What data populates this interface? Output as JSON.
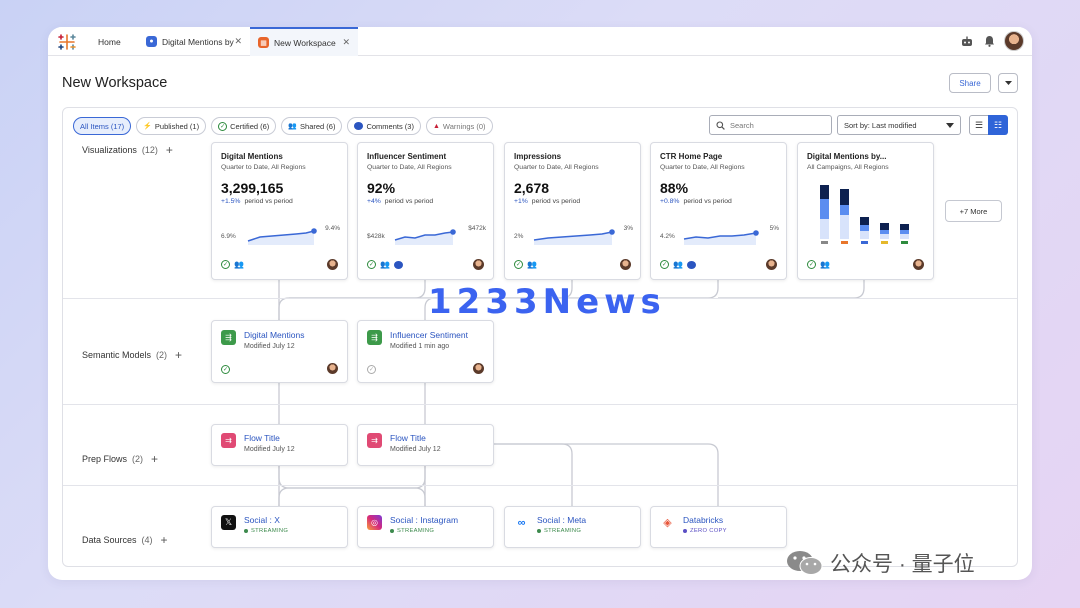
{
  "tabs": {
    "home": "Home",
    "tab1": "Digital Mentions by",
    "tab2": "New Workspace"
  },
  "page": {
    "title": "New Workspace",
    "share": "Share"
  },
  "filters": [
    {
      "label": "All Items (17)",
      "icon": "",
      "active": true
    },
    {
      "label": "Published (1)",
      "icon": "bolt-icon"
    },
    {
      "label": "Certified (6)",
      "icon": "certified-icon"
    },
    {
      "label": "Shared (6)",
      "icon": "shared-icon"
    },
    {
      "label": "Comments (3)",
      "icon": "comment-icon"
    },
    {
      "label": "Warnings (0)",
      "icon": "warning-icon"
    }
  ],
  "search": {
    "placeholder": "Search"
  },
  "sort": {
    "label": "Sort by: Last modified"
  },
  "sections": {
    "viz": {
      "label": "Visualizations",
      "count": "(12)"
    },
    "models": {
      "label": "Semantic Models",
      "count": "(2)"
    },
    "flows": {
      "label": "Prep Flows",
      "count": "(2)"
    },
    "sources": {
      "label": "Data Sources",
      "count": "(4)"
    }
  },
  "viz_cards": [
    {
      "title": "Digital Mentions",
      "sub": "Quarter to Date, All Regions",
      "value": "3,299,165",
      "pct": "+1.5%",
      "delta": "period vs period",
      "lo": "6.9%",
      "hi": "9.4%"
    },
    {
      "title": "Influencer Sentiment",
      "sub": "Quarter to Date, All Regions",
      "value": "92%",
      "pct": "+4%",
      "delta": "period vs period",
      "lo": "$428k",
      "hi": "$472k"
    },
    {
      "title": "Impressions",
      "sub": "Quarter to Date, All Regions",
      "value": "2,678",
      "pct": "+1%",
      "delta": "period vs period",
      "lo": "2%",
      "hi": "3%"
    },
    {
      "title": "CTR Home Page",
      "sub": "Quarter to Date, All Regions",
      "value": "88%",
      "pct": "+0.8%",
      "delta": "period vs period",
      "lo": "4.2%",
      "hi": "5%"
    },
    {
      "title": "Digital Mentions by...",
      "sub": "All Campaigns, All Regions"
    }
  ],
  "more_label": "+7 More",
  "models": [
    {
      "title": "Digital Mentions",
      "sub": "Modified July 12"
    },
    {
      "title": "Influencer Sentiment",
      "sub": "Modified 1 min ago"
    }
  ],
  "flows": [
    {
      "title": "Flow Title",
      "sub": "Modified July 12"
    },
    {
      "title": "Flow Title",
      "sub": "Modified July 12"
    }
  ],
  "sources": [
    {
      "title": "Social : X",
      "status": "STREAMING"
    },
    {
      "title": "Social : Instagram",
      "status": "STREAMING"
    },
    {
      "title": "Social : Meta",
      "status": "STREAMING"
    },
    {
      "title": "Databricks",
      "status": "ZERO COPY"
    }
  ],
  "watermark": "1233News",
  "wechat_caption": "公众号 · 量子位"
}
